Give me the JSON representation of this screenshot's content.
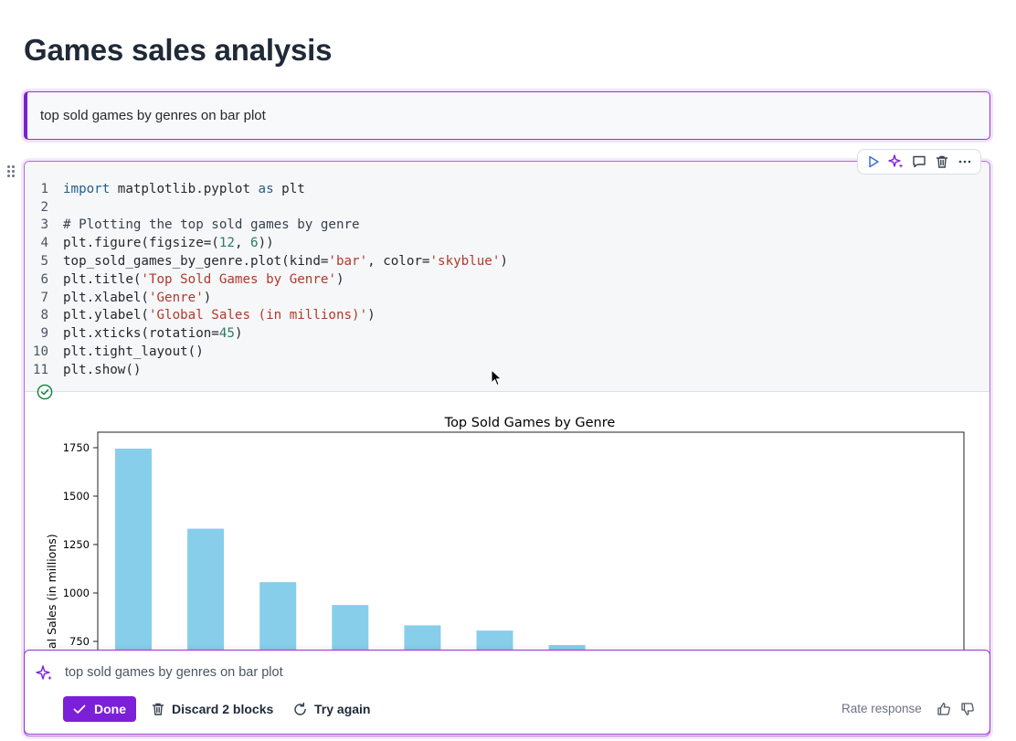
{
  "page": {
    "title": "Games sales analysis"
  },
  "prompt_block": {
    "text": "top sold games by genres on bar plot"
  },
  "code_cell": {
    "lines": [
      {
        "num": "1",
        "text": "import matplotlib.pyplot as plt"
      },
      {
        "num": "2",
        "text": ""
      },
      {
        "num": "3",
        "text": "# Plotting the top sold games by genre"
      },
      {
        "num": "4",
        "text": "plt.figure(figsize=(12, 6))"
      },
      {
        "num": "5",
        "text": "top_sold_games_by_genre.plot(kind='bar', color='skyblue')"
      },
      {
        "num": "6",
        "text": "plt.title('Top Sold Games by Genre')"
      },
      {
        "num": "7",
        "text": "plt.xlabel('Genre')"
      },
      {
        "num": "8",
        "text": "plt.ylabel('Global Sales (in millions)')"
      },
      {
        "num": "9",
        "text": "plt.xticks(rotation=45)"
      },
      {
        "num": "10",
        "text": "plt.tight_layout()"
      },
      {
        "num": "11",
        "text": "plt.show()"
      }
    ],
    "toolbar": [
      "play-icon",
      "sparkle-icon",
      "comment-icon",
      "trash-icon",
      "more-icon"
    ],
    "status": "success-check-icon"
  },
  "chart_data": {
    "type": "bar",
    "title": "Top Sold Games by Genre",
    "ylabel": "al Sales (in millions)",
    "y_ticks": [
      "750",
      "1000",
      "1250",
      "1500",
      "1750"
    ],
    "values": [
      1745,
      1332,
      1056,
      938,
      833,
      806,
      731
    ],
    "ylim": [
      655,
      1835
    ],
    "bar_color": "#87ceeb"
  },
  "ai_bar": {
    "prompt": "top sold games by genres on bar plot",
    "done_label": "Done",
    "discard_label": "Discard 2 blocks",
    "retry_label": "Try again",
    "rate_label": "Rate response"
  },
  "colors": {
    "accent": "#7c1fd8",
    "border": "#9b30d9"
  }
}
